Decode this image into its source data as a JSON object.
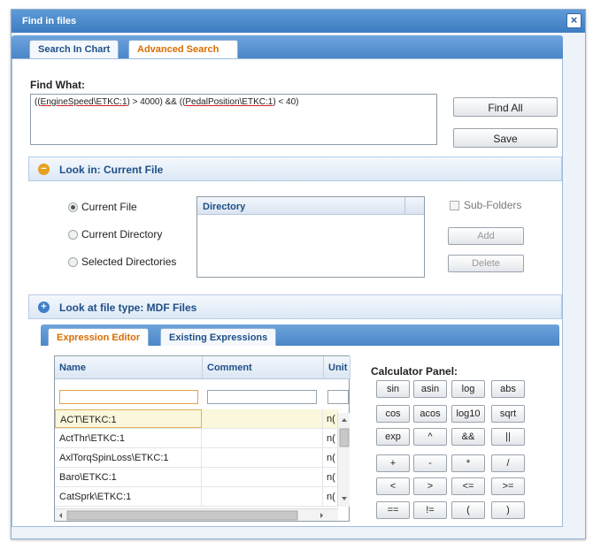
{
  "dialog": {
    "title": "Find in files",
    "close_glyph": "×"
  },
  "tabs": {
    "search_in_chart": "Search In Chart",
    "advanced_search": "Advanced Search"
  },
  "find": {
    "label": "Find What:",
    "expr_open": "((",
    "term1": "EngineSpeed\\ETKC:1",
    "expr_mid": ") > 4000) && ((",
    "term2": "PedalPosition\\ETKC:1",
    "expr_close": ") < 40)",
    "find_all_label": "Find All",
    "save_label": "Save"
  },
  "look_in": {
    "header": "Look in: Current File",
    "options": [
      "Current File",
      "Current Directory",
      "Selected Directories"
    ],
    "selected": "Current File",
    "directory_header": "Directory",
    "subfolders_label": "Sub-Folders",
    "add_label": "Add",
    "delete_label": "Delete"
  },
  "file_type": {
    "header": "Look at file type: MDF Files"
  },
  "expr_tabs": {
    "editor": "Expression Editor",
    "existing": "Existing Expressions"
  },
  "grid": {
    "columns": [
      "Name",
      "Comment",
      "Unit"
    ],
    "rows": [
      {
        "name": "ACT\\ETKC:1",
        "comment": "",
        "unit": "n("
      },
      {
        "name": "ActThr\\ETKC:1",
        "comment": "",
        "unit": "n("
      },
      {
        "name": "AxlTorqSpinLoss\\ETKC:1",
        "comment": "",
        "unit": "n("
      },
      {
        "name": "Baro\\ETKC:1",
        "comment": "",
        "unit": "n("
      },
      {
        "name": "CatSprk\\ETKC:1",
        "comment": "",
        "unit": "n("
      }
    ]
  },
  "calculator": {
    "title": "Calculator Panel:",
    "functions": [
      "sin",
      "asin",
      "log",
      "abs",
      "cos",
      "acos",
      "log10",
      "sqrt",
      "exp",
      "^",
      "&&",
      "||"
    ],
    "operators": [
      "+",
      "-",
      "*",
      "/",
      "<",
      ">",
      "<=",
      ">=",
      "==",
      "!=",
      "(",
      ")"
    ]
  },
  "colors": {
    "title_bar": "#4a88c9",
    "active_tab_text": "#d96d00",
    "section_text": "#1f4f86"
  }
}
